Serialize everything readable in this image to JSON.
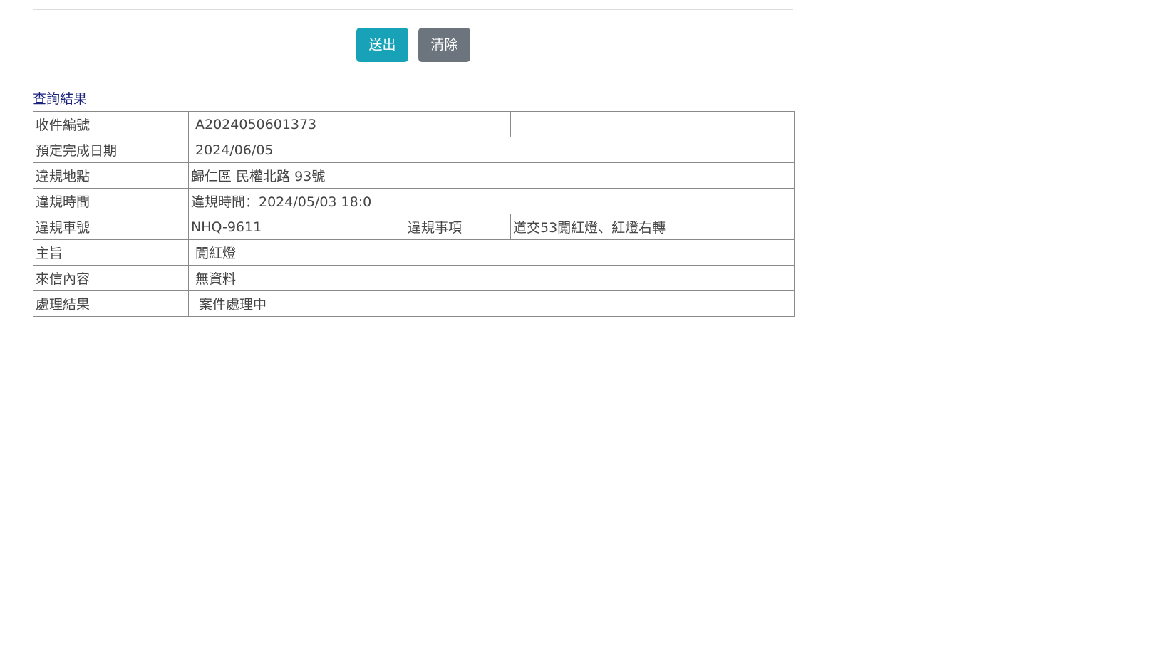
{
  "form": {
    "submit_label": "送出",
    "clear_label": "清除"
  },
  "result": {
    "title": "查詢結果",
    "rows": {
      "receipt_no": {
        "label": "收件編號",
        "value": "A2024050601373",
        "extra_label": "",
        "extra_value": ""
      },
      "due_date": {
        "label": "預定完成日期",
        "value": "2024/06/05"
      },
      "location": {
        "label": "違規地點",
        "value": "歸仁區 民權北路 93號"
      },
      "time": {
        "label": "違規時間",
        "value": "違規時間：2024/05/03 18:0"
      },
      "plate": {
        "label": "違規車號",
        "value": "NHQ-9611",
        "extra_label": "違規事項",
        "extra_value": "道交53闖紅燈、紅燈右轉"
      },
      "subject": {
        "label": "主旨",
        "value": "闖紅燈"
      },
      "content": {
        "label": "來信內容",
        "value": "無資料"
      },
      "outcome": {
        "label": "處理結果",
        "value": "案件處理中"
      }
    }
  }
}
